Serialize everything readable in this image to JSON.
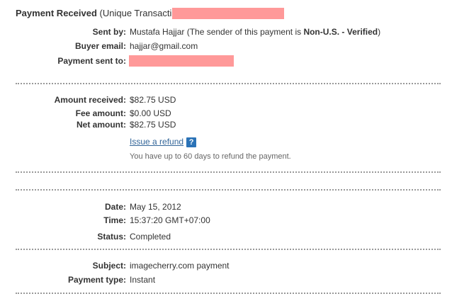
{
  "header": {
    "title_bold": "Payment Received",
    "title_rest": " (Unique Transaction"
  },
  "sender": {
    "sent_by_label": "Sent by:",
    "sent_by_name": "Mustafa Hajjar (The sender of this payment is ",
    "sent_by_status": "Non-U.S. - Verified",
    "sent_by_close": ")",
    "buyer_email_label": "Buyer email:",
    "buyer_email_value": "hajjar@gmail.com",
    "payment_sent_to_label": "Payment sent to:"
  },
  "amounts": {
    "received_label": "Amount received:",
    "received_value": "$82.75 USD",
    "fee_label": "Fee amount:",
    "fee_value": "$0.00 USD",
    "net_label": "Net amount:",
    "net_value": "$82.75 USD",
    "refund_link": "Issue a refund",
    "refund_help": "?",
    "refund_note": "You have up to 60 days to refund the payment."
  },
  "details": {
    "date_label": "Date:",
    "date_value": "May 15, 2012",
    "time_label": "Time:",
    "time_value": "15:37:20 GMT+07:00",
    "status_label": "Status:",
    "status_value": "Completed"
  },
  "subject": {
    "subject_label": "Subject:",
    "subject_value": "imagecherry.com payment",
    "type_label": "Payment type:",
    "type_value": "Instant"
  },
  "colors": {
    "redaction": "#ff9999",
    "link": "#336699",
    "help_icon": "#2b73b7"
  }
}
